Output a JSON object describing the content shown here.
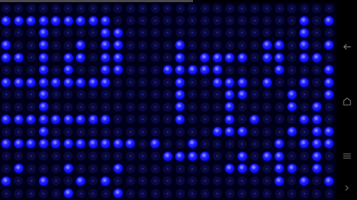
{
  "game": {
    "grid_rows": 16,
    "grid_cols": 27,
    "colors": {
      "background": "#000000",
      "board": "#00001a",
      "led_on": "#0c0cf2",
      "led_off": "#09093f",
      "nav_icon": "#7a7a7a",
      "status_strip": "#4a4a4a"
    },
    "lit_pattern": [
      "000000000000000000000000000",
      "111111111000000000000000101",
      "000100001100000000000000100",
      "100100101100001000000110101",
      "110101101100001011110110110",
      "000101001100011111000010001",
      "111111111000001001110100101",
      "000100000000001000110001001",
      "000100000000001000100001010",
      "111111111000001000101000110",
      "000100000000000001110001011",
      "111111111110100100000010111",
      "000000000000011110010110010",
      "010001000100000000111011010",
      "100100101000000000000010101",
      "000001000100000000000000000"
    ]
  },
  "navigation": {
    "back_icon": "back-arrow-icon",
    "home_icon": "home-icon",
    "menu_icon": "menu-icon",
    "more_icon": "chevron-right-icon"
  }
}
